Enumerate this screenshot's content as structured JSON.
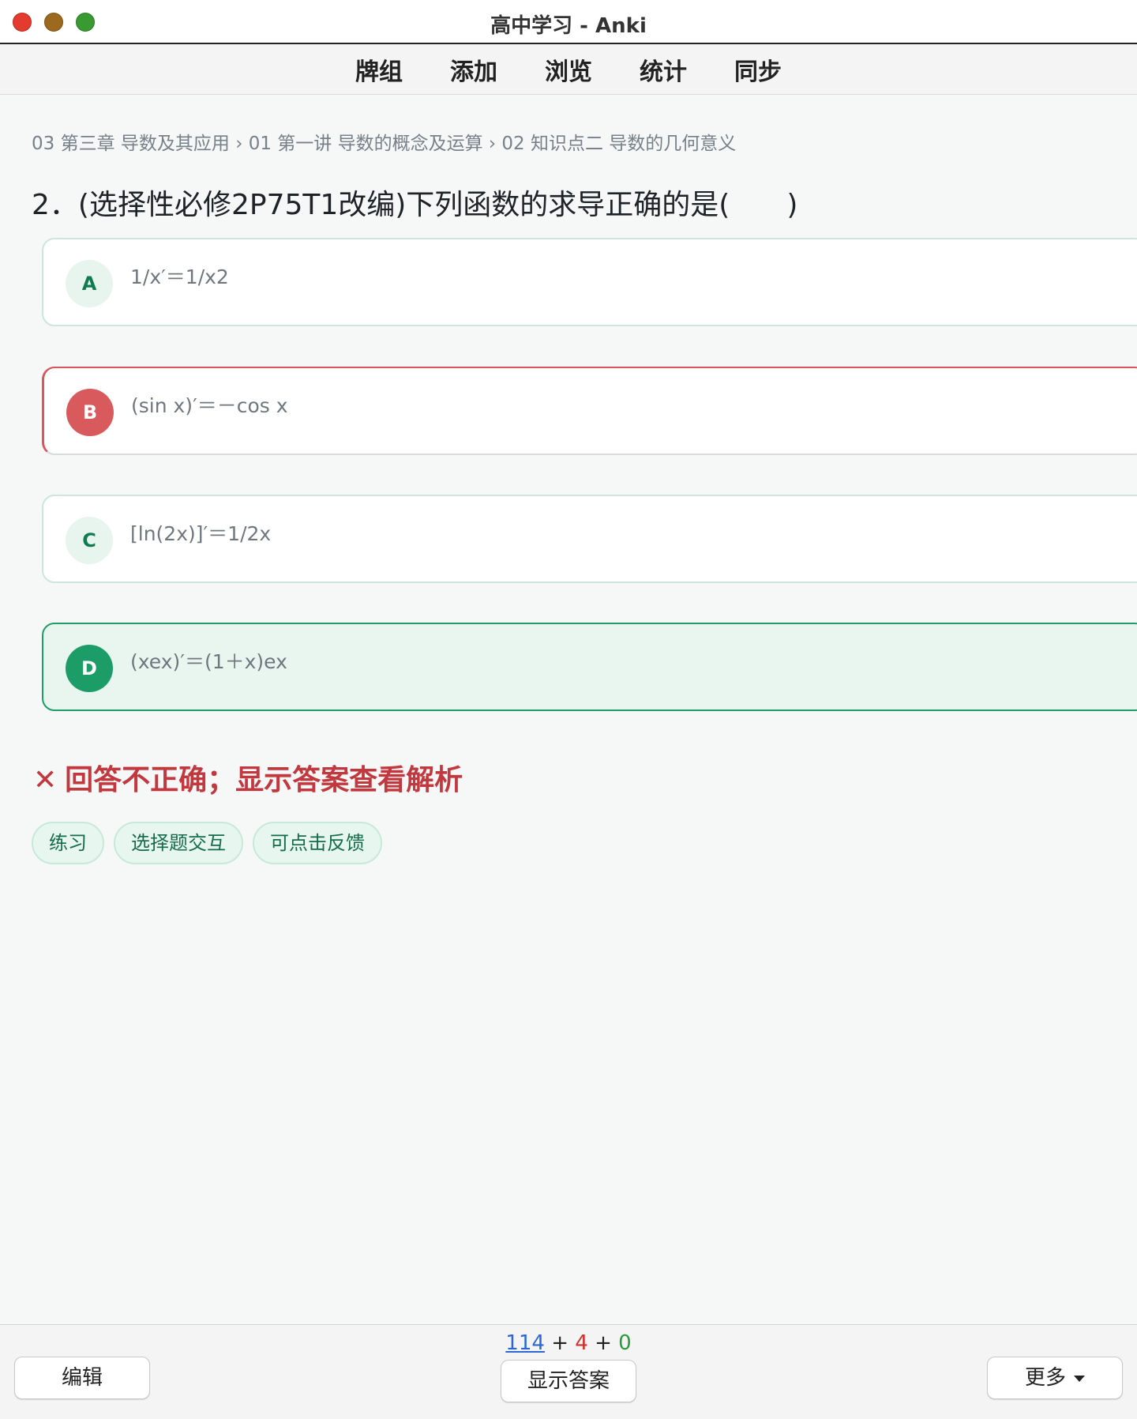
{
  "window": {
    "title": "高中学习 - Anki"
  },
  "menu": [
    "牌组",
    "添加",
    "浏览",
    "统计",
    "同步"
  ],
  "breadcrumb": "03 第三章 导数及其应用 › 01 第一讲 导数的概念及运算 › 02 知识点二 导数的几何意义",
  "question": "2．(选择性必修2P75T1改编)下列函数的求导正确的是(　　)",
  "options": [
    {
      "letter": "A",
      "text": "1/x′＝1/x2",
      "state": "normal"
    },
    {
      "letter": "B",
      "text": "(sin x)′＝－cos x",
      "state": "wrong"
    },
    {
      "letter": "C",
      "text": "[ln(2x)]′＝1/2x",
      "state": "normal"
    },
    {
      "letter": "D",
      "text": "(xex)′＝(1＋x)ex",
      "state": "correct"
    }
  ],
  "result": {
    "icon": "✕",
    "text": "回答不正确；显示答案查看解析"
  },
  "tags": [
    "练习",
    "选择题交互",
    "可点击反馈"
  ],
  "bottom": {
    "edit_label": "编辑",
    "show_answer_label": "显示答案",
    "more_label": "更多",
    "counts": {
      "new": "114",
      "learning": "4",
      "review": "0",
      "sep": "+"
    }
  },
  "colors": {
    "accent_green": "#1c9d68",
    "wrong_red": "#d95a5d",
    "new_blue": "#2d67d6",
    "learn_red": "#d2302b",
    "review_green": "#2a9a3c"
  }
}
